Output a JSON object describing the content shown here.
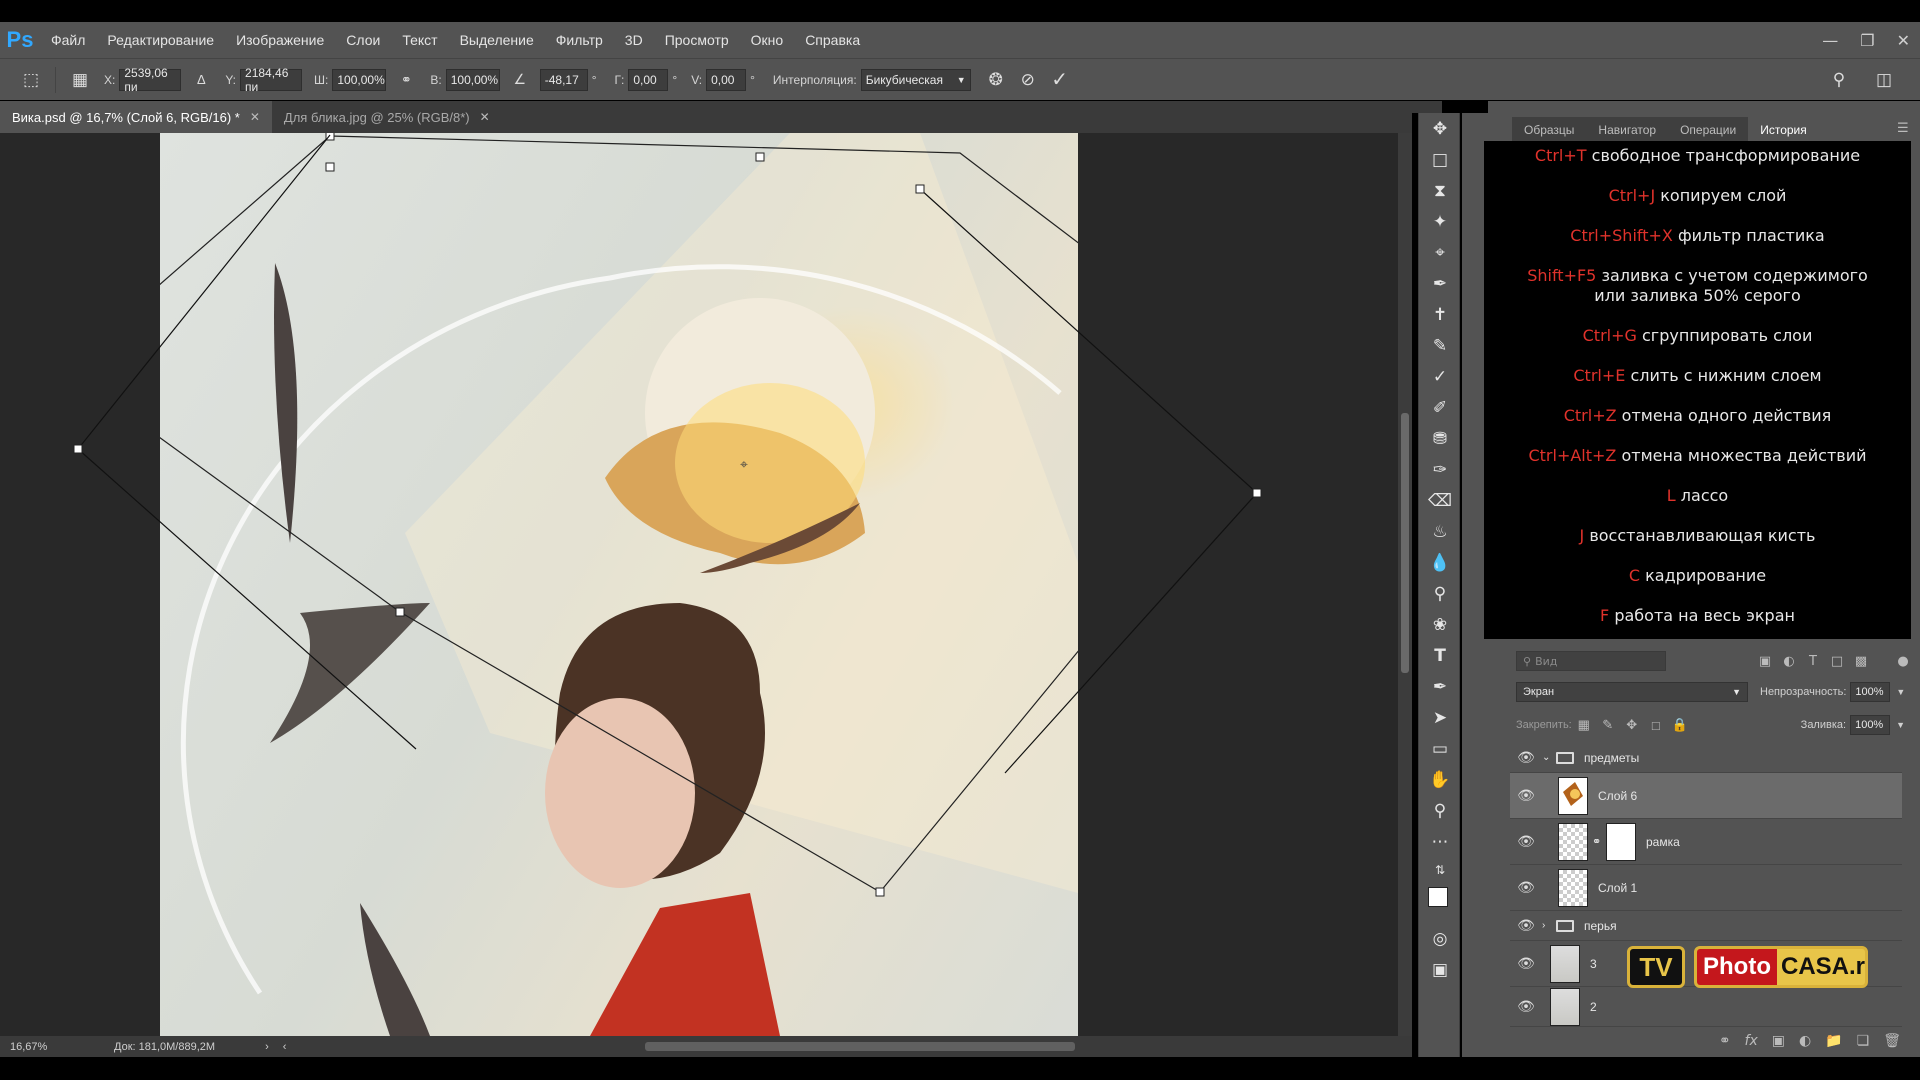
{
  "app": {
    "logo": "Ps",
    "menu": [
      "Файл",
      "Редактирование",
      "Изображение",
      "Слои",
      "Текст",
      "Выделение",
      "Фильтр",
      "3D",
      "Просмотр",
      "Окно",
      "Справка"
    ],
    "window_controls": [
      "minimize-icon",
      "restore-icon",
      "close-icon"
    ]
  },
  "options": {
    "x_label": "X:",
    "x_value": "2539,06 пи",
    "y_label": "Y:",
    "y_value": "2184,46 пи",
    "w_label": "Ш:",
    "w_value": "100,00%",
    "h_label": "В:",
    "h_value": "100,00%",
    "angle_value": "-48,17",
    "angle_unit": "°",
    "hskew_label": "Г:",
    "hskew_value": "0,00",
    "vskew_label": "V:",
    "vskew_value": "0,00",
    "interp_label": "Интерполяция:",
    "interp_value": "Бикубическая"
  },
  "tabs": [
    {
      "label": "Вика.psd @ 16,7% (Слой 6, RGB/16) *",
      "active": true
    },
    {
      "label": "Для блика.jpg @ 25% (RGB/8*)",
      "active": false
    }
  ],
  "status": {
    "zoom": "16,67%",
    "doc": "Док: 181,0M/889,2M"
  },
  "panels": {
    "tabs": [
      "Образцы",
      "Навигатор",
      "Операции",
      "История"
    ],
    "active_tab": "История"
  },
  "shortcuts": [
    {
      "key": "Ctrl+T",
      "text": " свободное трансформирование"
    },
    {
      "key": "Ctrl+J",
      "text": " копируем слой"
    },
    {
      "key": "Ctrl+Shift+X",
      "text": " фильтр пластика"
    },
    {
      "key": "Shift+F5",
      "text": " заливка с учетом содержимого",
      "line2": "или  заливка 50% серого"
    },
    {
      "key": "Ctrl+G",
      "text": " сгруппировать слои"
    },
    {
      "key": "Ctrl+E",
      "text": " слить с нижним слоем"
    },
    {
      "key": "Ctrl+Z",
      "text": " отмена одного действия"
    },
    {
      "key": "Ctrl+Alt+Z",
      "text": " отмена множества действий"
    },
    {
      "key": "L",
      "text": " лассо"
    },
    {
      "key": "J",
      "text": " восстанавливающая кисть"
    },
    {
      "key": "C",
      "text": " кадрирование"
    },
    {
      "key": "F",
      "text": " работа на весь экран"
    }
  ],
  "layers": {
    "filter_placeholder": "Вид",
    "blend_mode": "Экран",
    "opacity_label": "Непрозрачность:",
    "opacity": "100%",
    "lock_label": "Закрепить:",
    "fill_label": "Заливка:",
    "fill": "100%",
    "items": [
      {
        "name": "предметы",
        "type": "group"
      },
      {
        "name": "Слой 6",
        "type": "layer",
        "selected": true
      },
      {
        "name": "рамка",
        "type": "layer"
      },
      {
        "name": "Слой 1",
        "type": "layer"
      },
      {
        "name": "перья",
        "type": "group"
      },
      {
        "name": "3",
        "type": "layer"
      },
      {
        "name": "2",
        "type": "layer"
      }
    ]
  },
  "watermark": {
    "tv": "TV",
    "photo": "Photo",
    "casa": "CASA.ru"
  }
}
